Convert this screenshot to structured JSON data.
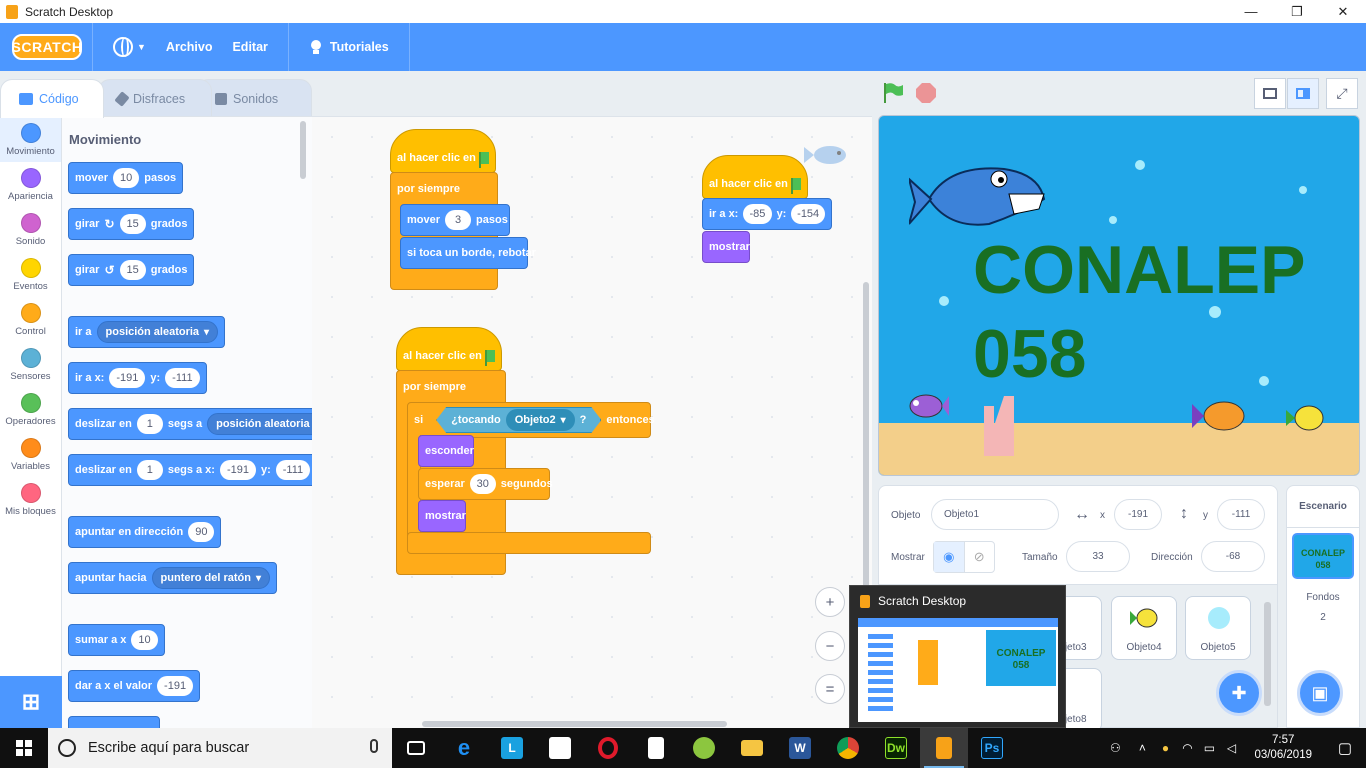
{
  "window": {
    "title": "Scratch Desktop",
    "controls": [
      "—",
      "❐",
      "✕"
    ]
  },
  "menu": {
    "logo": "SCRATCH",
    "archivo": "Archivo",
    "editar": "Editar",
    "tutoriales": "Tutoriales"
  },
  "tabs": {
    "codigo": "Código",
    "disfraces": "Disfraces",
    "sonidos": "Sonidos"
  },
  "categories": [
    {
      "label": "Movimiento",
      "color": "#4c97ff"
    },
    {
      "label": "Apariencia",
      "color": "#9966ff"
    },
    {
      "label": "Sonido",
      "color": "#cf63cf"
    },
    {
      "label": "Eventos",
      "color": "#ffd500"
    },
    {
      "label": "Control",
      "color": "#ffab19"
    },
    {
      "label": "Sensores",
      "color": "#5cb1d6"
    },
    {
      "label": "Operadores",
      "color": "#59c059"
    },
    {
      "label": "Variables",
      "color": "#ff8c1a"
    },
    {
      "label": "Mis bloques",
      "color": "#ff6680"
    }
  ],
  "palette": {
    "title": "Movimiento",
    "mover": {
      "a": "mover",
      "v": "10",
      "b": "pasos"
    },
    "girar_r": {
      "a": "girar",
      "v": "15",
      "b": "grados"
    },
    "girar_l": {
      "a": "girar",
      "v": "15",
      "b": "grados"
    },
    "ir_a": {
      "a": "ir a",
      "dd": "posición aleatoria"
    },
    "ir_a_xy": {
      "a": "ir a x:",
      "x": "-191",
      "b": "y:",
      "y": "-111"
    },
    "deslizar1": {
      "a": "deslizar en",
      "v": "1",
      "b": "segs a",
      "dd": "posición aleatoria"
    },
    "deslizar2": {
      "a": "deslizar en",
      "v": "1",
      "b": "segs a x:",
      "x": "-191",
      "c": "y:",
      "y": "-111"
    },
    "apuntar_dir": {
      "a": "apuntar en dirección",
      "v": "90"
    },
    "apuntar_hacia": {
      "a": "apuntar hacia",
      "dd": "puntero del ratón"
    },
    "sumar_x": {
      "a": "sumar a x",
      "v": "10"
    },
    "dar_x": {
      "a": "dar a x el valor",
      "v": "-191"
    }
  },
  "scripts": {
    "s1": {
      "hat": "al hacer clic en",
      "forever": "por siempre",
      "move_a": "mover",
      "move_v": "3",
      "move_b": "pasos",
      "bounce": "si toca un borde, rebotar"
    },
    "s2": {
      "hat": "al hacer clic en",
      "goto_a": "ir a x:",
      "x": "-85",
      "goto_b": "y:",
      "y": "-154",
      "show": "mostrar"
    },
    "s3": {
      "hat": "al hacer clic en",
      "forever": "por siempre",
      "if": "si",
      "touching": "¿tocando",
      "target": "Objeto2",
      "q": "?",
      "then": "entonces",
      "hide": "esconder",
      "wait_a": "esperar",
      "wait_v": "30",
      "wait_b": "segundos",
      "show": "mostrar"
    }
  },
  "zoom": {
    "in": "+",
    "out": "−",
    "reset": "="
  },
  "stage": {
    "line1": "CONALEP",
    "line2": "058"
  },
  "info": {
    "objeto_label": "Objeto",
    "objeto": "Objeto1",
    "x_label": "x",
    "x": "-191",
    "y_label": "y",
    "y": "-111",
    "mostrar_label": "Mostrar",
    "tamano_label": "Tamaño",
    "tamano": "33",
    "direccion_label": "Dirección",
    "direccion": "-68"
  },
  "sprites": [
    "Objeto3",
    "Objeto4",
    "Objeto5",
    "Objeto8"
  ],
  "stage_panel": {
    "title": "Escenario",
    "thumb1": "CONALEP",
    "thumb2": "058",
    "fondos_label": "Fondos",
    "fondos": "2"
  },
  "preview": {
    "title": "Scratch Desktop",
    "thumb1": "CONALEP",
    "thumb2": "058"
  },
  "taskbar": {
    "search": "Escribe aquí para buscar",
    "time": "7:57",
    "date": "03/06/2019"
  }
}
